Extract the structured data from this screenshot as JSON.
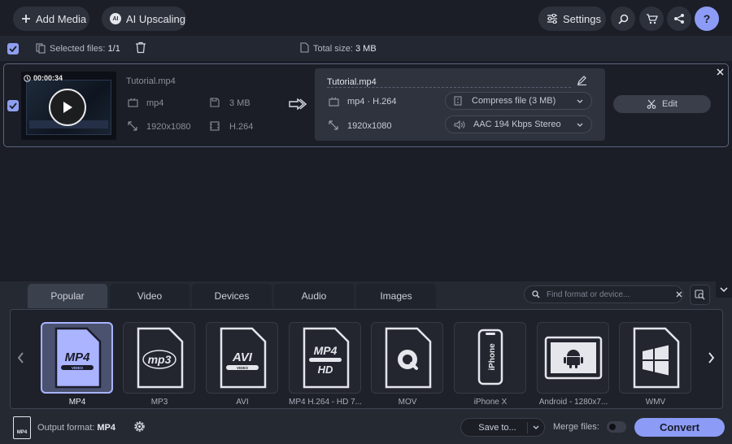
{
  "toolbar": {
    "add_media": "Add Media",
    "ai_upscaling": "AI Upscaling",
    "ai_badge": "AI",
    "settings": "Settings"
  },
  "selection": {
    "selected_label": "Selected files:",
    "selected_count": "1/1",
    "total_label": "Total size:",
    "total_value": "3 MB"
  },
  "file": {
    "duration": "00:00:34",
    "name": "Tutorial.mp4",
    "format": "mp4",
    "size": "3 MB",
    "resolution": "1920x1080",
    "codec": "H.264",
    "output_name": "Tutorial.mp4",
    "output_format": "mp4 · H.264",
    "output_resolution": "1920x1080",
    "compress": "Compress file (3 MB)",
    "audio": "AAC 194 Kbps Stereo",
    "edit": "Edit"
  },
  "tabs": [
    "Popular",
    "Video",
    "Devices",
    "Audio",
    "Images"
  ],
  "search": {
    "placeholder": "Find format or device..."
  },
  "formats": [
    {
      "label": "MP4",
      "line1": "MP4",
      "line2": "VIDEO"
    },
    {
      "label": "MP3",
      "line1": "mp3",
      "line2": ""
    },
    {
      "label": "AVI",
      "line1": "AVI",
      "line2": "VIDEO"
    },
    {
      "label": "MP4 H.264 - HD 7...",
      "line1": "MP4",
      "line2": "HD"
    },
    {
      "label": "MOV",
      "line1": "",
      "line2": ""
    },
    {
      "label": "iPhone X",
      "line1": "iPhone",
      "line2": ""
    },
    {
      "label": "Android - 1280x7...",
      "line1": "",
      "line2": ""
    },
    {
      "label": "WMV",
      "line1": "",
      "line2": ""
    }
  ],
  "footer": {
    "output_label": "Output format:",
    "output_value": "MP4",
    "format_icon_text": "MP4",
    "save_to": "Save to...",
    "merge": "Merge files:",
    "convert": "Convert"
  },
  "colors": {
    "accent": "#8c9cf6",
    "selected_border": "#a9b3ff",
    "background": "#1b1e26"
  }
}
